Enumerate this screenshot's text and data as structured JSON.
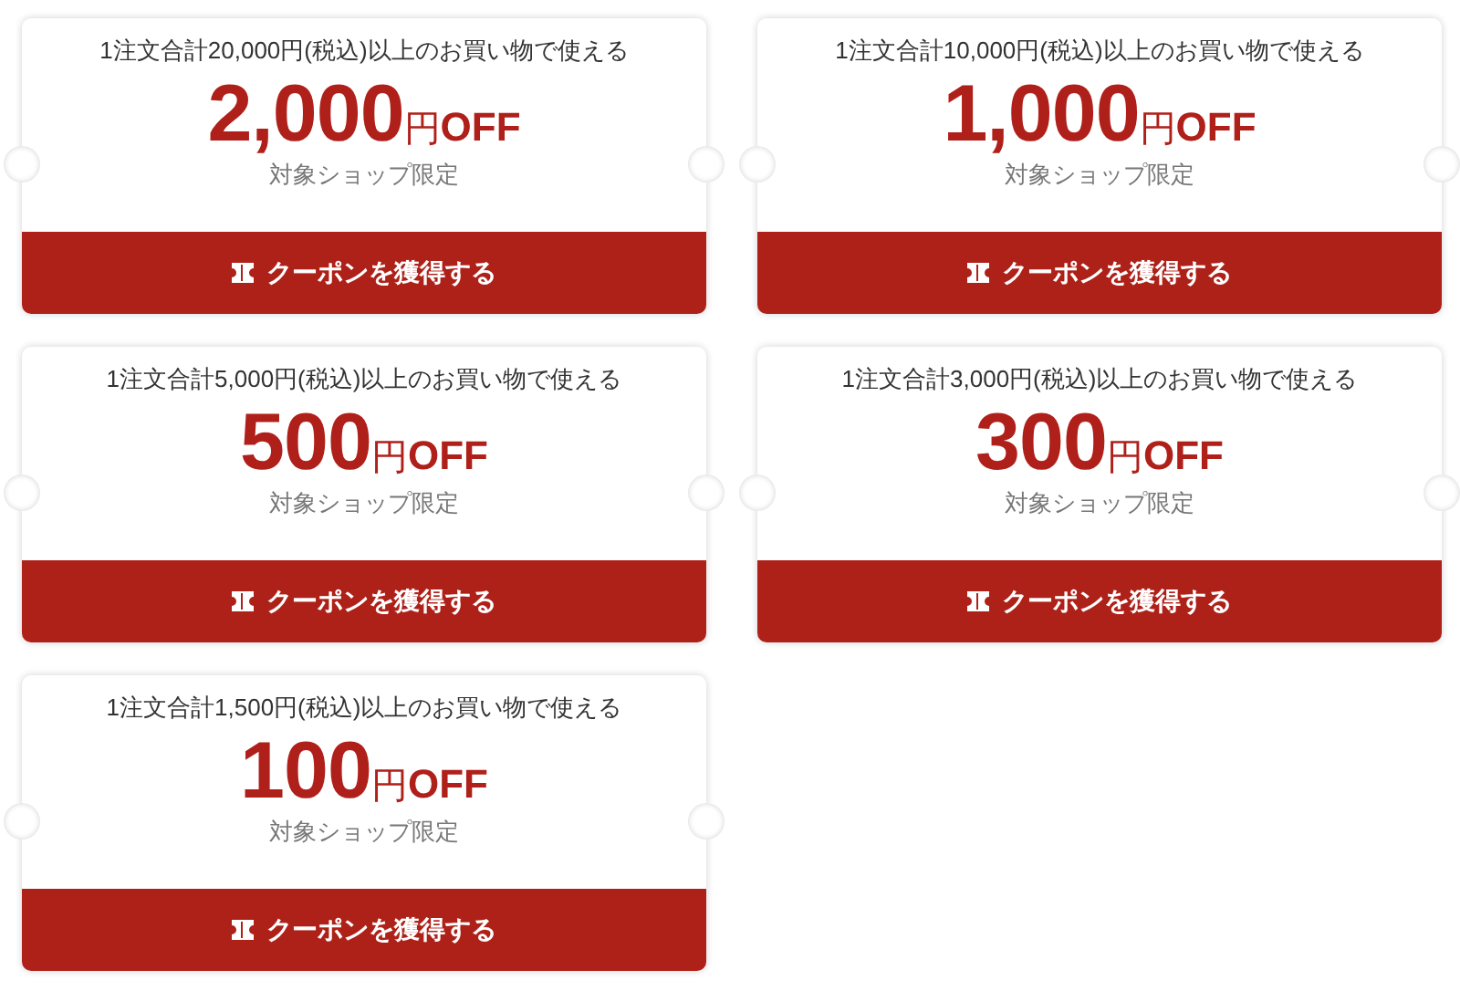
{
  "coupons": [
    {
      "condition": "1注文合計20,000円(税込)以上のお買い物で使える",
      "amount": "2,000",
      "unit": "円",
      "suffix": "OFF",
      "scope": "対象ショップ限定",
      "button": "クーポンを獲得する"
    },
    {
      "condition": "1注文合計10,000円(税込)以上のお買い物で使える",
      "amount": "1,000",
      "unit": "円",
      "suffix": "OFF",
      "scope": "対象ショップ限定",
      "button": "クーポンを獲得する"
    },
    {
      "condition": "1注文合計5,000円(税込)以上のお買い物で使える",
      "amount": "500",
      "unit": "円",
      "suffix": "OFF",
      "scope": "対象ショップ限定",
      "button": "クーポンを獲得する"
    },
    {
      "condition": "1注文合計3,000円(税込)以上のお買い物で使える",
      "amount": "300",
      "unit": "円",
      "suffix": "OFF",
      "scope": "対象ショップ限定",
      "button": "クーポンを獲得する"
    },
    {
      "condition": "1注文合計1,500円(税込)以上のお買い物で使える",
      "amount": "100",
      "unit": "円",
      "suffix": "OFF",
      "scope": "対象ショップ限定",
      "button": "クーポンを獲得する"
    }
  ]
}
